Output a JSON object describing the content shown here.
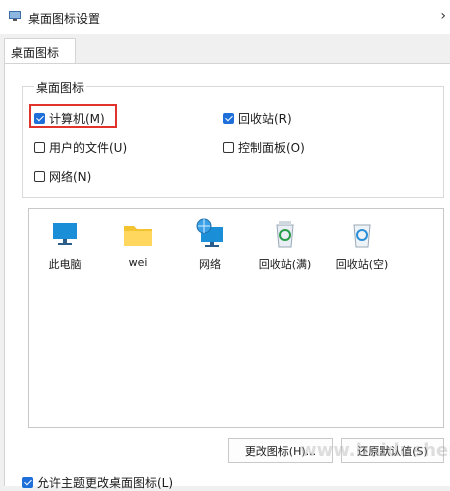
{
  "window": {
    "title": "桌面图标设置",
    "close_glyph": "›"
  },
  "tab": {
    "label": "桌面图标"
  },
  "group": {
    "title": "桌面图标",
    "checkboxes": [
      {
        "label": "计算机(M)",
        "checked": true
      },
      {
        "label": "回收站(R)",
        "checked": true
      },
      {
        "label": "用户的文件(U)",
        "checked": false
      },
      {
        "label": "控制面板(O)",
        "checked": false
      },
      {
        "label": "网络(N)",
        "checked": false
      }
    ]
  },
  "icons": [
    {
      "label": "此电脑",
      "icon": "monitor-icon"
    },
    {
      "label": "wei",
      "icon": "folder-icon"
    },
    {
      "label": "网络",
      "icon": "network-icon"
    },
    {
      "label": "回收站(满)",
      "icon": "recycle-bin-full-icon"
    },
    {
      "label": "回收站(空)",
      "icon": "recycle-bin-empty-icon"
    }
  ],
  "buttons": {
    "change_icon": "更改图标(H)...",
    "restore_default": "还原默认值(S)"
  },
  "bottom_checkbox": {
    "label": "允许主题更改桌面图标(L)",
    "checked": true
  },
  "watermark": "www.baidushenq.com",
  "colors": {
    "accent": "#1e6fd9",
    "highlight": "#e0332c"
  }
}
